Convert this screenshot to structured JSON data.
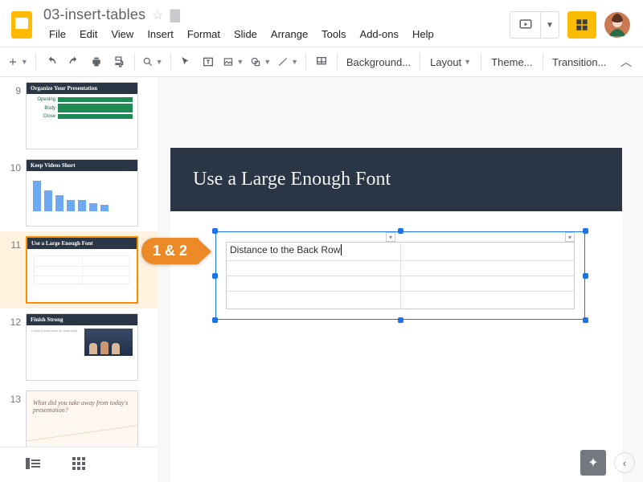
{
  "doc": {
    "title": "03-insert-tables"
  },
  "menus": [
    "File",
    "Edit",
    "View",
    "Insert",
    "Format",
    "Slide",
    "Arrange",
    "Tools",
    "Add-ons",
    "Help"
  ],
  "toolbar": {
    "background": "Background...",
    "layout": "Layout",
    "theme": "Theme...",
    "transition": "Transition..."
  },
  "slides": [
    {
      "num": "9",
      "title": "Organize Your Presentation",
      "labels": [
        "Opening",
        "Body",
        "Close"
      ]
    },
    {
      "num": "10",
      "title": "Keep Videos Short"
    },
    {
      "num": "11",
      "title": "Use a Large Enough Font",
      "selected": true
    },
    {
      "num": "12",
      "title": "Finish Strong"
    },
    {
      "num": "13",
      "title": "What did you take away from today's presentation?",
      "plain": true
    }
  ],
  "canvas": {
    "title": "Use a Large Enough Font",
    "table_cell": "Distance to the Back Row"
  },
  "callout": "1 & 2"
}
